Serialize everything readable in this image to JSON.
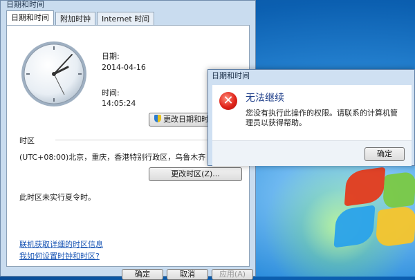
{
  "main_window": {
    "title": "日期和时间",
    "tabs": [
      "日期和时间",
      "附加时钟",
      "Internet 时间"
    ],
    "date_label": "日期:",
    "date_value": "2014-04-16",
    "time_label": "时间:",
    "time_value": "14:05:24",
    "change_datetime_button": "更改日期和时",
    "timezone_section_label": "时区",
    "timezone_value": "(UTC+08:00)北京，重庆，香港特别行政区，乌鲁木齐",
    "change_timezone_button": "更改时区(Z)...",
    "dst_text": "此时区未实行夏令时。",
    "link_online": "联机获取详细的时区信息",
    "link_howto": "我如何设置时钟和时区?",
    "bottom_buttons": [
      "确定",
      "取消",
      "应用(A)"
    ]
  },
  "dialog": {
    "title": "日期和时间",
    "heading": "无法继续",
    "message": "您没有执行此操作的权限。请联系的计算机管理员以获得帮助。",
    "ok_button": "确定"
  },
  "colors": {
    "link": "#1a56b5",
    "dialog_heading": "#1f3f8a",
    "error_icon": "#e0241a"
  }
}
